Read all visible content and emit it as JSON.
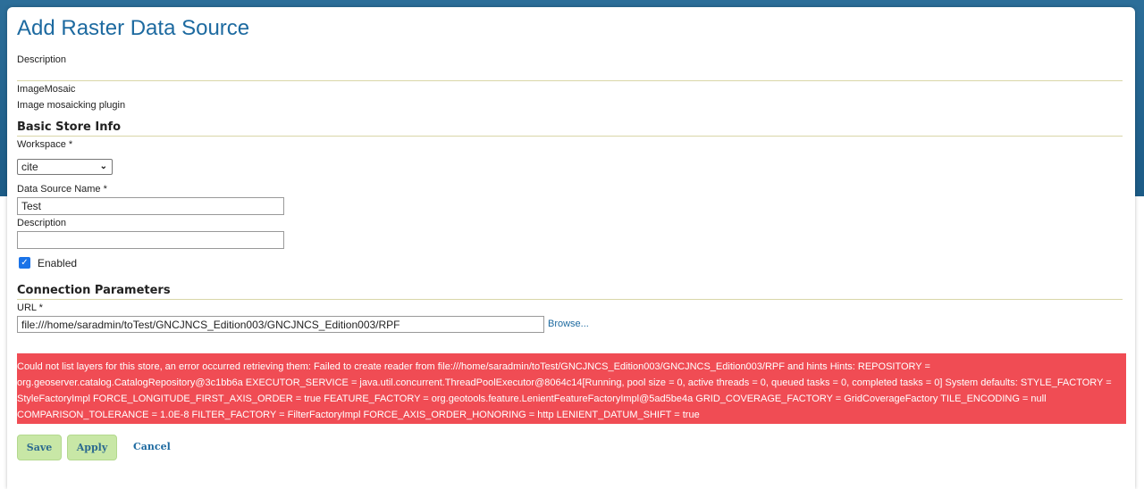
{
  "page": {
    "title": "Add Raster Data Source",
    "description_label": "Description",
    "plugin_name": "ImageMosaic",
    "plugin_description": "Image mosaicking plugin"
  },
  "basic_store_info": {
    "title": "Basic Store Info",
    "workspace_label": "Workspace *",
    "workspace_value": "cite",
    "data_source_name_label": "Data Source Name *",
    "data_source_name_value": "Test",
    "description_label": "Description",
    "description_value": "",
    "enabled_label": "Enabled",
    "enabled": true
  },
  "connection_parameters": {
    "title": "Connection Parameters",
    "url_label": "URL *",
    "url_value": "file:///home/saradmin/toTest/GNCJNCS_Edition003/GNCJNCS_Edition003/RPF",
    "browse_label": "Browse..."
  },
  "error": {
    "message": "Could not list layers for this store, an error occurred retrieving them: Failed to create reader from file:///home/saradmin/toTest/GNCJNCS_Edition003/GNCJNCS_Edition003/RPF and hints Hints: REPOSITORY = org.geoserver.catalog.CatalogRepository@3c1bb6a EXECUTOR_SERVICE = java.util.concurrent.ThreadPoolExecutor@8064c14[Running, pool size = 0, active threads = 0, queued tasks = 0, completed tasks = 0] System defaults: STYLE_FACTORY = StyleFactoryImpl FORCE_LONGITUDE_FIRST_AXIS_ORDER = true FEATURE_FACTORY = org.geotools.feature.LenientFeatureFactoryImpl@5ad5be4a GRID_COVERAGE_FACTORY = GridCoverageFactory TILE_ENCODING = null COMPARISON_TOLERANCE = 1.0E-8 FILTER_FACTORY = FilterFactoryImpl FORCE_AXIS_ORDER_HONORING = http LENIENT_DATUM_SHIFT = true"
  },
  "actions": {
    "save_label": "Save",
    "apply_label": "Apply",
    "cancel_label": "Cancel"
  },
  "colors": {
    "title": "#1d6aa0",
    "error_bg": "#f04c54",
    "button_bg": "#c8e7a6",
    "header_band": "#2c6e99"
  }
}
